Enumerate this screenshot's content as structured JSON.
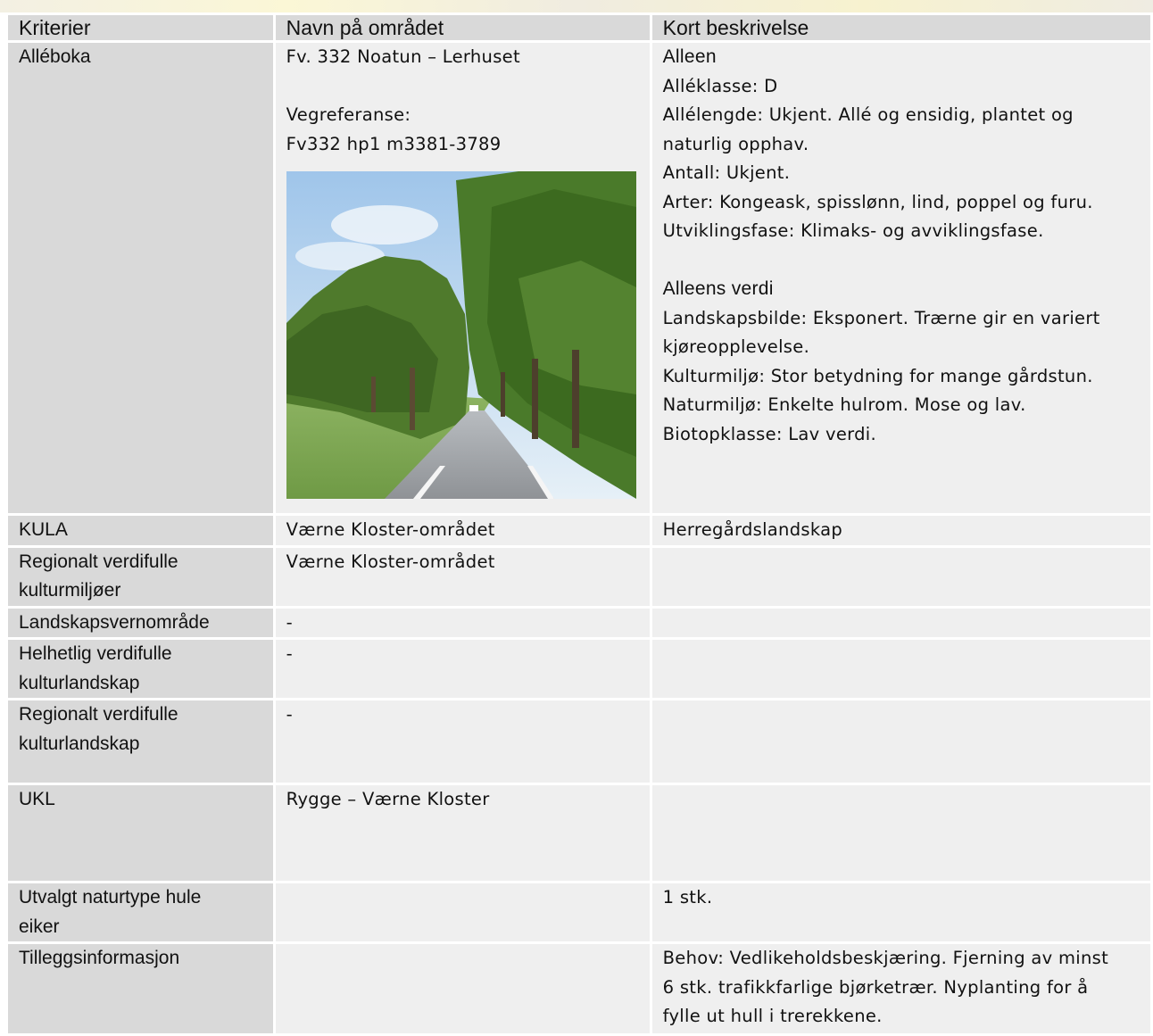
{
  "header": {
    "col1": "Kriterier",
    "col2": "Navn på området",
    "col3": "Kort beskrivelse"
  },
  "rows": [
    {
      "label": "Alléboka",
      "name_lines": [
        "Fv. 332 Noatun – Lerhuset",
        "",
        "Vegreferanse:",
        "Fv332 hp1 m3381-3789"
      ],
      "description": {
        "heading1": "Alleen",
        "lines1": [
          "Alléklasse: D",
          "Allélengde: Ukjent. Allé og ensidig, plantet og",
          "naturlig opphav.",
          "Antall: Ukjent.",
          "Arter: Kongeask, spisslønn, lind, poppel og furu.",
          "Utviklingsfase: Klimaks- og avviklingsfase."
        ],
        "heading2": "Alleens verdi",
        "lines2": [
          "Landskapsbilde: Eksponert. Trærne gir en variert",
          "kjøreopplevelse.",
          "Kulturmiljø: Stor betydning for mange gårdstun.",
          "Naturmiljø: Enkelte hulrom. Mose og lav.",
          "Biotopklasse: Lav verdi."
        ]
      }
    },
    {
      "label": "KULA",
      "name": "Værne Kloster-området",
      "desc": "Herregårdslandskap"
    },
    {
      "label_lines": [
        "Regionalt verdifulle",
        "kulturmiljøer"
      ],
      "name": "Værne Kloster-området",
      "desc": ""
    },
    {
      "label": "Landskapsvernområde",
      "name": "-",
      "desc": ""
    },
    {
      "label_lines": [
        "Helhetlig verdifulle",
        "kulturlandskap"
      ],
      "name": "-",
      "desc": ""
    },
    {
      "label_lines": [
        "Regionalt verdifulle",
        "kulturlandskap"
      ],
      "name": "-",
      "desc": ""
    },
    {
      "label": "UKL",
      "name": "Rygge – Værne Kloster",
      "desc": ""
    },
    {
      "label_lines": [
        "Utvalgt naturtype hule",
        "eiker"
      ],
      "name": "",
      "desc": "1 stk."
    },
    {
      "label": "Tilleggsinformasjon",
      "name": "",
      "desc_lines": [
        "Behov: Vedlikeholdsbeskjæring. Fjerning av minst",
        "6 stk. trafikkfarlige bjørketrær. Nyplanting for å",
        "fylle ut hull i trerekkene."
      ]
    }
  ]
}
